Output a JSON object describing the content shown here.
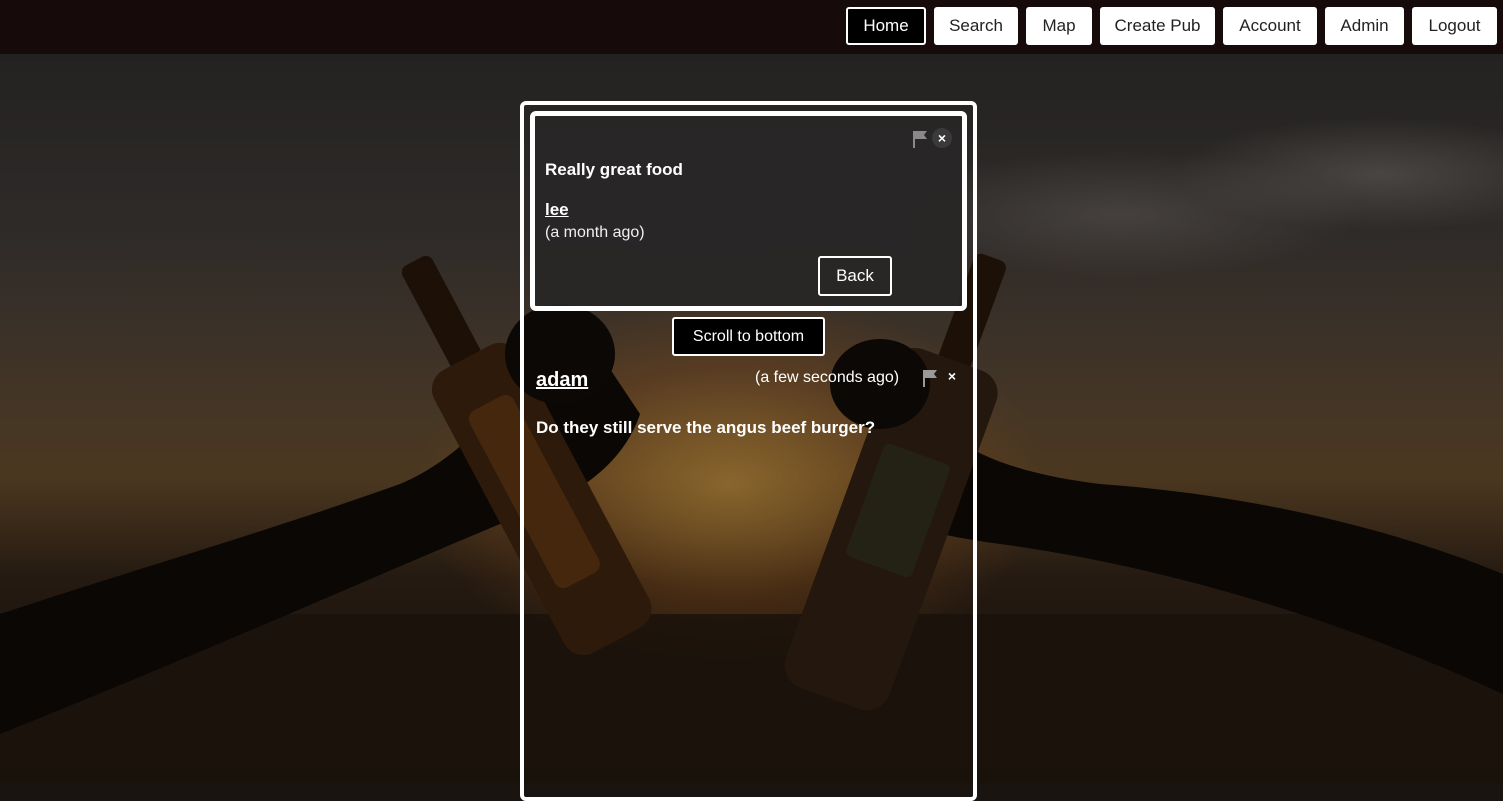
{
  "nav": {
    "items": [
      {
        "label": "Home",
        "active": true
      },
      {
        "label": "Search",
        "active": false
      },
      {
        "label": "Map",
        "active": false
      },
      {
        "label": "Create Pub",
        "active": false
      },
      {
        "label": "Account",
        "active": false
      },
      {
        "label": "Admin",
        "active": false
      },
      {
        "label": "Logout",
        "active": false
      }
    ]
  },
  "review": {
    "title": "Really great food",
    "author": "lee",
    "time": "(a month ago)",
    "back_label": "Back",
    "flag_icon": "flag-icon",
    "close_icon": "close-icon"
  },
  "scroll_label": "Scroll to bottom",
  "comments": [
    {
      "author": "adam",
      "time": "(a few seconds ago)",
      "text": "Do they still serve the angus beef burger?"
    }
  ],
  "colors": {
    "navbar_bg": "#170a0b",
    "accent_border": "#ffffff"
  }
}
